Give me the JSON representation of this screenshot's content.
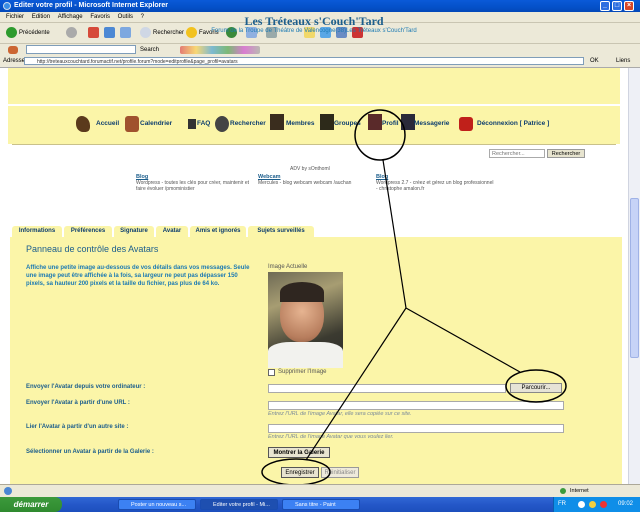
{
  "window": {
    "title": "Editer votre profil - Microsoft Internet Explorer"
  },
  "menu": [
    "Fichier",
    "Edition",
    "Affichage",
    "Favoris",
    "Outils",
    "?"
  ],
  "toolbar": {
    "back_label": "Précédente",
    "search_label": "Rechercher",
    "favorites_label": "Favoris",
    "search2_label": "Search"
  },
  "address": {
    "label": "Adresse",
    "url": "http://treteauxcouchtard.forumactif.net/profile.forum?mode=editprofile&page_profil=avatars",
    "go_label": "OK",
    "links_label": "Liens"
  },
  "site": {
    "title": "Les Tréteaux s'Couch'Tard",
    "subtitle": "Forum de la Troupe de Théâtre de Valencogne(38)Les Tréteaux s'Couch'Tard"
  },
  "nav": [
    {
      "label": "Accueil",
      "icon": "home-icon"
    },
    {
      "label": "Calendrier",
      "icon": "calendar-icon"
    },
    {
      "label": "FAQ",
      "icon": "faq-icon"
    },
    {
      "label": "Rechercher",
      "icon": "search-icon"
    },
    {
      "label": "Membres",
      "icon": "members-icon"
    },
    {
      "label": "Groupes",
      "icon": "groups-icon"
    },
    {
      "label": "Profil",
      "icon": "profile-icon"
    },
    {
      "label": "Messagerie",
      "icon": "mail-icon"
    },
    {
      "label": "Déconnexion [ Patrice ]",
      "icon": "power-icon"
    }
  ],
  "search": {
    "placeholder": "Rechercher...",
    "button_label": "Rechercher"
  },
  "ads": {
    "label": "ADV by sOnthoml",
    "items": [
      {
        "title": "Blog",
        "text": "Wordpress - toutes les clés pour créer, maintenir et faire évoluer /pmoministier"
      },
      {
        "title": "Webcam",
        "text": "Mercules - blog webcam webcam /auchan"
      },
      {
        "title": "Blog",
        "text": "Wordpress 2.7 - créez et gérez un blog professionnel - christophe amalon.fr"
      }
    ]
  },
  "tabs": [
    "Informations",
    "Préférences",
    "Signature",
    "Avatar",
    "Amis et ignorés",
    "Sujets surveillés"
  ],
  "panel": {
    "title": "Panneau de contrôle des Avatars",
    "description": "Affiche une petite image au-dessous de vos détails dans vos messages. Seule une image peut être affichée à la fois, sa largeur ne peut pas dépasser 150 pixels, sa hauteur 200 pixels et la taille du fichier, pas plus de 64 ko.",
    "current_image_label": "Image Actuelle",
    "delete_image_label": "Supprimer l'Image",
    "upload_label": "Envoyer l'Avatar depuis votre ordinateur :",
    "browse_label": "Parcourir...",
    "url_label": "Envoyer l'Avatar à partir d'une URL :",
    "url_hint": "Entrez l'URL de l'image Avatar, elle sera copiée sur ce site.",
    "link_label": "Lier l'Avatar à partir d'un autre site :",
    "link_hint": "Entrez l'URL de l'image Avatar que vous voulez lier.",
    "gallery_label": "Sélectionner un Avatar à partir de la Galerie :",
    "gallery_button": "Montrer la Galerie",
    "save_button": "Enregistrer",
    "reset_button": "Réinitialiser"
  },
  "status": {
    "zone": "Internet"
  },
  "taskbar": {
    "start_label": "démarrer",
    "tasks": [
      {
        "label": "Poster un nouveau s...",
        "active": false
      },
      {
        "label": "Editer votre profil - Mi...",
        "active": true
      },
      {
        "label": "Sans titre - Paint",
        "active": false
      }
    ],
    "tray_language": "FR",
    "clock": "09:02"
  },
  "colors": {
    "site_yellow": "#fbf5a8",
    "title_blue": "#1c5e8c",
    "xp_blue": "#0a5ad8",
    "start_green": "#3c9a3c"
  }
}
